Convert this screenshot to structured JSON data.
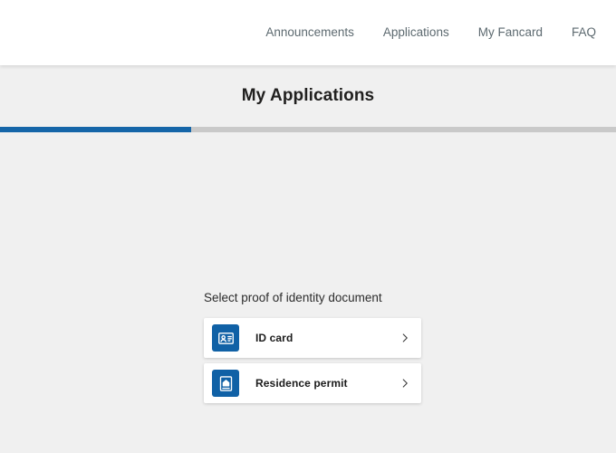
{
  "header": {
    "brand_label": "",
    "nav": [
      {
        "label": "Announcements",
        "name": "nav-announcements"
      },
      {
        "label": "Applications",
        "name": "nav-applications"
      },
      {
        "label": "My Fancard",
        "name": "nav-my-fancard"
      },
      {
        "label": "FAQ",
        "name": "nav-faq"
      }
    ]
  },
  "page": {
    "title": "My Applications"
  },
  "progress": {
    "percent": 31,
    "fill_color": "#1565a8",
    "track_color": "#c9c9c9",
    "value_text": "31%"
  },
  "selector": {
    "label": "Select proof of identity document",
    "options": [
      {
        "label": "ID card",
        "icon": "id-card-icon",
        "icon_tile_color": "#1061a6",
        "chevron": "chevron-right-icon"
      },
      {
        "label": "Residence permit",
        "icon": "residence-permit-icon",
        "icon_tile_color": "#1061a6",
        "chevron": "chevron-right-icon"
      }
    ]
  },
  "colors": {
    "background": "#f0f0f0",
    "header_background": "#ffffff",
    "accent_blue": "#1061a6",
    "nav_text": "#5d6a70",
    "title_text": "#21201f"
  }
}
